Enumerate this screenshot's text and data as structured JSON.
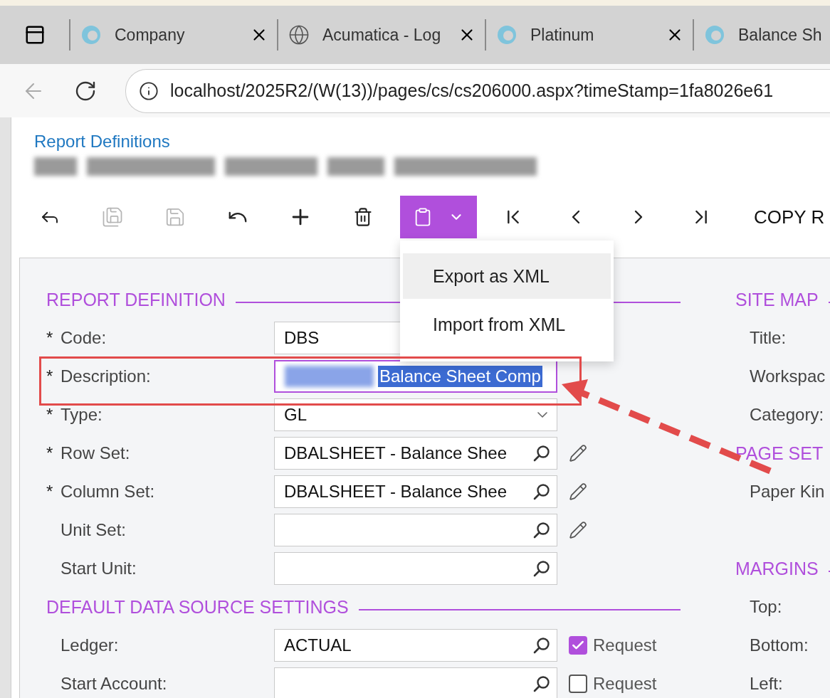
{
  "browser_tabs": [
    {
      "kind": "app",
      "label": "Company"
    },
    {
      "kind": "globe",
      "label": "Acumatica - Log"
    },
    {
      "kind": "app",
      "label": "Platinum"
    },
    {
      "kind": "app",
      "label": "Balance Sh"
    }
  ],
  "address_bar": {
    "url": "localhost/2025R2/(W(13))/pages/cs/cs206000.aspx?timeStamp=1fa8026e61"
  },
  "breadcrumb": "Report Definitions",
  "toolbar": [
    {
      "kind": "back",
      "disabled": false
    },
    {
      "kind": "save-close",
      "disabled": true
    },
    {
      "kind": "save",
      "disabled": true
    },
    {
      "kind": "undo",
      "disabled": false
    },
    {
      "kind": "add",
      "disabled": false
    },
    {
      "kind": "delete",
      "disabled": false
    },
    {
      "kind": "clipboard-menu",
      "disabled": false
    },
    {
      "kind": "first",
      "disabled": false
    },
    {
      "kind": "prev",
      "disabled": false
    },
    {
      "kind": "next",
      "disabled": false
    },
    {
      "kind": "last",
      "disabled": false
    },
    {
      "kind": "text",
      "label": "COPY R",
      "disabled": false
    }
  ],
  "clipboard_menu": [
    {
      "label": "Export as XML",
      "selected": true
    },
    {
      "label": "Import from XML",
      "selected": false
    }
  ],
  "left_sections": [
    {
      "title": "REPORT DEFINITION",
      "fields": [
        {
          "label": "Code:",
          "required_mark": "*",
          "kind": "text",
          "value": "DBS"
        },
        {
          "label": "Description:",
          "required_mark": "*",
          "kind": "selected-text",
          "value": "Balance Sheet Comp",
          "focused": true
        },
        {
          "label": "Type:",
          "required_mark": "*",
          "kind": "select",
          "value": "GL"
        },
        {
          "label": "Row Set:",
          "required_mark": "*",
          "kind": "lookup",
          "value": "DBALSHEET - Balance Shee",
          "editable": true
        },
        {
          "label": "Column Set:",
          "required_mark": "*",
          "kind": "lookup",
          "value": "DBALSHEET - Balance Shee",
          "editable": true
        },
        {
          "label": "Unit Set:",
          "kind": "lookup",
          "editable": true
        },
        {
          "label": "Start Unit:",
          "kind": "lookup"
        }
      ]
    },
    {
      "title": "DEFAULT DATA SOURCE SETTINGS",
      "fields": [
        {
          "label": "Ledger:",
          "kind": "lookup",
          "value": "ACTUAL",
          "request": {
            "label": "Request",
            "checked": true
          }
        },
        {
          "label": "Start Account:",
          "kind": "lookup",
          "request": {
            "label": "Request",
            "checked": false
          }
        }
      ]
    }
  ],
  "right_sections": [
    {
      "title": "SITE MAP",
      "fields": [
        "Title:",
        "Workspac",
        "Category:"
      ]
    },
    {
      "title": "PAGE SET",
      "fields": [
        "Paper Kin"
      ]
    },
    {
      "title": "MARGINS",
      "fields": [
        "Top:",
        "Bottom:",
        "Left:"
      ]
    }
  ]
}
